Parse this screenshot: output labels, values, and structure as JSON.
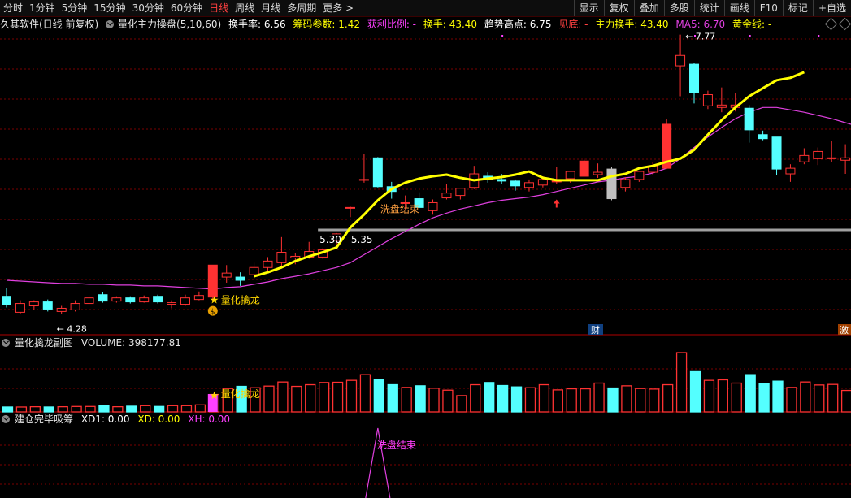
{
  "toolbar": {
    "periods": [
      "分时",
      "1分钟",
      "5分钟",
      "15分钟",
      "30分钟",
      "60分钟",
      "日线",
      "周线",
      "月线",
      "多周期",
      "更多 >"
    ],
    "active_index": 6,
    "right_items": [
      "显示",
      "复权",
      "叠加",
      "多股",
      "统计",
      "画线",
      "F10",
      "标记",
      "+自选"
    ]
  },
  "info": {
    "app": "久其软件(日线 前复权)",
    "indicator": "量化主力操盘(5,10,60)",
    "huanshou": "换手率: 6.56",
    "chouma": "筹码参数: 1.42",
    "huoli": "获利比例: -",
    "huanshou2": "换手: 43.40",
    "qushi": "趋势高点: 6.75",
    "jiandi": "见底: -",
    "zhuli": "主力换手: 43.40",
    "ma5": "MA5: 6.70",
    "huangjin": "黄金线: -"
  },
  "annotations": {
    "high": "7.77",
    "low": "4.28",
    "range": "5.30 - 5.35",
    "signal": "量化擒龙",
    "wash": "洗盘结束",
    "cai": "财",
    "ji": "激"
  },
  "volume_panel": {
    "title": "量化擒龙副图",
    "volume": "VOLUME: 398177.81"
  },
  "xd_panel": {
    "title": "建仓完毕吸筹",
    "xd1": "XD1: 0.00",
    "xd": "XD: 0.00",
    "xh": "XH: 0.00"
  },
  "colors": {
    "up": "#ff3232",
    "down": "#54ffff",
    "grey": "#c0c0c0",
    "yellow": "#ffff00",
    "magenta": "#e040e0",
    "grid": "#7a0000",
    "panel_sep": "#b00000",
    "label_orange": "#ffa040"
  },
  "chart_data": {
    "type": "candlestick",
    "price_candles": [
      {
        "o": 4.5,
        "h": 4.6,
        "l": 4.36,
        "c": 4.4
      },
      {
        "o": 4.3,
        "h": 4.45,
        "l": 4.28,
        "c": 4.41
      },
      {
        "o": 4.38,
        "h": 4.45,
        "l": 4.33,
        "c": 4.43
      },
      {
        "o": 4.43,
        "h": 4.46,
        "l": 4.31,
        "c": 4.34
      },
      {
        "o": 4.31,
        "h": 4.38,
        "l": 4.28,
        "c": 4.35
      },
      {
        "o": 4.33,
        "h": 4.45,
        "l": 4.31,
        "c": 4.41
      },
      {
        "o": 4.41,
        "h": 4.52,
        "l": 4.4,
        "c": 4.48
      },
      {
        "o": 4.52,
        "h": 4.55,
        "l": 4.42,
        "c": 4.44
      },
      {
        "o": 4.44,
        "h": 4.5,
        "l": 4.42,
        "c": 4.48
      },
      {
        "o": 4.48,
        "h": 4.5,
        "l": 4.41,
        "c": 4.43
      },
      {
        "o": 4.43,
        "h": 4.51,
        "l": 4.42,
        "c": 4.48
      },
      {
        "o": 4.5,
        "h": 4.52,
        "l": 4.41,
        "c": 4.43
      },
      {
        "o": 4.4,
        "h": 4.45,
        "l": 4.35,
        "c": 4.42
      },
      {
        "o": 4.4,
        "h": 4.52,
        "l": 4.38,
        "c": 4.48
      },
      {
        "o": 4.46,
        "h": 4.56,
        "l": 4.45,
        "c": 4.51
      },
      {
        "o": 4.49,
        "h": 4.89,
        "l": 4.43,
        "c": 4.89
      },
      {
        "o": 4.74,
        "h": 4.89,
        "l": 4.67,
        "c": 4.79
      },
      {
        "o": 4.74,
        "h": 4.8,
        "l": 4.63,
        "c": 4.7
      },
      {
        "o": 4.77,
        "h": 4.92,
        "l": 4.71,
        "c": 4.86
      },
      {
        "o": 4.86,
        "h": 4.99,
        "l": 4.82,
        "c": 4.94
      },
      {
        "o": 4.92,
        "h": 5.24,
        "l": 4.88,
        "c": 5.05
      },
      {
        "o": 4.98,
        "h": 5.04,
        "l": 4.9,
        "c": 5.0
      },
      {
        "o": 4.99,
        "h": 5.18,
        "l": 4.97,
        "c": 5.06
      },
      {
        "o": 4.99,
        "h": 5.1,
        "l": 4.97,
        "c": 5.08
      },
      {
        "o": 5.2,
        "h": 5.29,
        "l": 5.1,
        "c": 5.28
      },
      {
        "o": 5.61,
        "h": 5.62,
        "l": 5.49,
        "c": 5.61
      },
      {
        "o": 5.96,
        "h": 6.28,
        "l": 5.92,
        "c": 5.96
      },
      {
        "o": 6.23,
        "h": 6.24,
        "l": 5.86,
        "c": 5.87
      },
      {
        "o": 5.87,
        "h": 5.93,
        "l": 5.72,
        "c": 5.81
      },
      {
        "o": 5.66,
        "h": 5.76,
        "l": 5.58,
        "c": 5.67
      },
      {
        "o": 5.72,
        "h": 5.8,
        "l": 5.61,
        "c": 5.61
      },
      {
        "o": 5.57,
        "h": 5.71,
        "l": 5.52,
        "c": 5.67
      },
      {
        "o": 5.73,
        "h": 5.9,
        "l": 5.71,
        "c": 5.79
      },
      {
        "o": 5.76,
        "h": 5.85,
        "l": 5.71,
        "c": 5.85
      },
      {
        "o": 5.86,
        "h": 6.13,
        "l": 5.84,
        "c": 6.03
      },
      {
        "o": 6.0,
        "h": 6.05,
        "l": 5.92,
        "c": 5.96
      },
      {
        "o": 5.96,
        "h": 6.03,
        "l": 5.9,
        "c": 5.94
      },
      {
        "o": 5.94,
        "h": 5.96,
        "l": 5.82,
        "c": 5.88
      },
      {
        "o": 5.86,
        "h": 5.96,
        "l": 5.81,
        "c": 5.92
      },
      {
        "o": 5.89,
        "h": 6.0,
        "l": 5.86,
        "c": 5.96
      },
      {
        "o": 5.94,
        "h": 6.12,
        "l": 5.9,
        "c": 5.94
      },
      {
        "o": 5.97,
        "h": 6.06,
        "l": 5.92,
        "c": 6.06
      },
      {
        "o": 6.0,
        "h": 6.22,
        "l": 6.0,
        "c": 6.19
      },
      {
        "o": 6.02,
        "h": 6.16,
        "l": 5.98,
        "c": 6.05
      },
      {
        "o": 6.09,
        "h": 6.12,
        "l": 5.7,
        "c": 5.72
      },
      {
        "o": 5.86,
        "h": 5.99,
        "l": 5.81,
        "c": 5.96
      },
      {
        "o": 5.96,
        "h": 6.06,
        "l": 5.93,
        "c": 6.06
      },
      {
        "o": 6.05,
        "h": 6.18,
        "l": 6.02,
        "c": 6.13
      },
      {
        "o": 6.1,
        "h": 6.71,
        "l": 6.09,
        "c": 6.65
      },
      {
        "o": 7.38,
        "h": 7.77,
        "l": 7.0,
        "c": 7.51
      },
      {
        "o": 7.4,
        "h": 7.42,
        "l": 6.91,
        "c": 7.05
      },
      {
        "o": 6.88,
        "h": 7.07,
        "l": 6.84,
        "c": 7.02
      },
      {
        "o": 6.86,
        "h": 7.11,
        "l": 6.8,
        "c": 6.89
      },
      {
        "o": 6.86,
        "h": 7.04,
        "l": 6.81,
        "c": 6.89
      },
      {
        "o": 6.85,
        "h": 6.89,
        "l": 6.42,
        "c": 6.58
      },
      {
        "o": 6.52,
        "h": 6.57,
        "l": 6.45,
        "c": 6.47
      },
      {
        "o": 6.49,
        "h": 6.49,
        "l": 6.01,
        "c": 6.09
      },
      {
        "o": 6.03,
        "h": 6.15,
        "l": 5.93,
        "c": 6.1
      },
      {
        "o": 6.18,
        "h": 6.35,
        "l": 6.15,
        "c": 6.26
      },
      {
        "o": 6.22,
        "h": 6.36,
        "l": 6.14,
        "c": 6.31
      },
      {
        "o": 6.23,
        "h": 6.44,
        "l": 6.18,
        "c": 6.23
      },
      {
        "o": 6.2,
        "h": 6.4,
        "l": 6.03,
        "c": 6.23
      },
      {
        "o": 6.2,
        "h": 6.31,
        "l": 6.1,
        "c": 6.23
      }
    ],
    "ma_line": [
      4.7,
      4.69,
      4.68,
      4.67,
      4.66,
      4.66,
      4.65,
      4.65,
      4.64,
      4.64,
      4.63,
      4.63,
      4.62,
      4.61,
      4.6,
      4.59,
      4.61,
      4.62,
      4.65,
      4.68,
      4.72,
      4.75,
      4.78,
      4.82,
      4.86,
      4.92,
      5.02,
      5.12,
      5.22,
      5.31,
      5.4,
      5.48,
      5.54,
      5.59,
      5.63,
      5.67,
      5.7,
      5.72,
      5.74,
      5.77,
      5.81,
      5.85,
      5.89,
      5.93,
      5.95,
      5.98,
      6.0,
      6.04,
      6.1,
      6.22,
      6.36,
      6.49,
      6.61,
      6.72,
      6.8,
      6.86,
      6.86,
      6.83,
      6.8,
      6.76,
      6.72,
      6.67,
      6.62,
      6.57
    ],
    "yellow_line": {
      "start": 18,
      "values": [
        4.75,
        4.8,
        4.86,
        4.94,
        5.0,
        5.05,
        5.11,
        5.36,
        5.52,
        5.7,
        5.84,
        5.92,
        5.97,
        6.0,
        6.02,
        5.98,
        5.95,
        5.97,
        5.99,
        6.02,
        6.06,
        5.98,
        5.95,
        5.95,
        5.95,
        5.95,
        6.0,
        6.03,
        6.1,
        6.13,
        6.18,
        6.22,
        6.33,
        6.52,
        6.7,
        6.86,
        7.0,
        7.1,
        7.2,
        7.23,
        7.3
      ]
    },
    "volume_bars": [
      180,
      180,
      190,
      180,
      190,
      200,
      200,
      230,
      190,
      210,
      230,
      200,
      230,
      230,
      260,
      640,
      860,
      940,
      890,
      950,
      1100,
      940,
      1000,
      1080,
      1090,
      1160,
      1370,
      1180,
      1000,
      900,
      960,
      870,
      800,
      600,
      1000,
      1080,
      970,
      920,
      890,
      1000,
      810,
      850,
      850,
      1060,
      880,
      960,
      860,
      840,
      1000,
      2180,
      1480,
      1160,
      1180,
      1060,
      1370,
      1050,
      1130,
      900,
      1100,
      990,
      1010,
      790,
      700
    ],
    "xd_peak_index": 27,
    "ylim_price": [
      4.04,
      8.0
    ]
  }
}
